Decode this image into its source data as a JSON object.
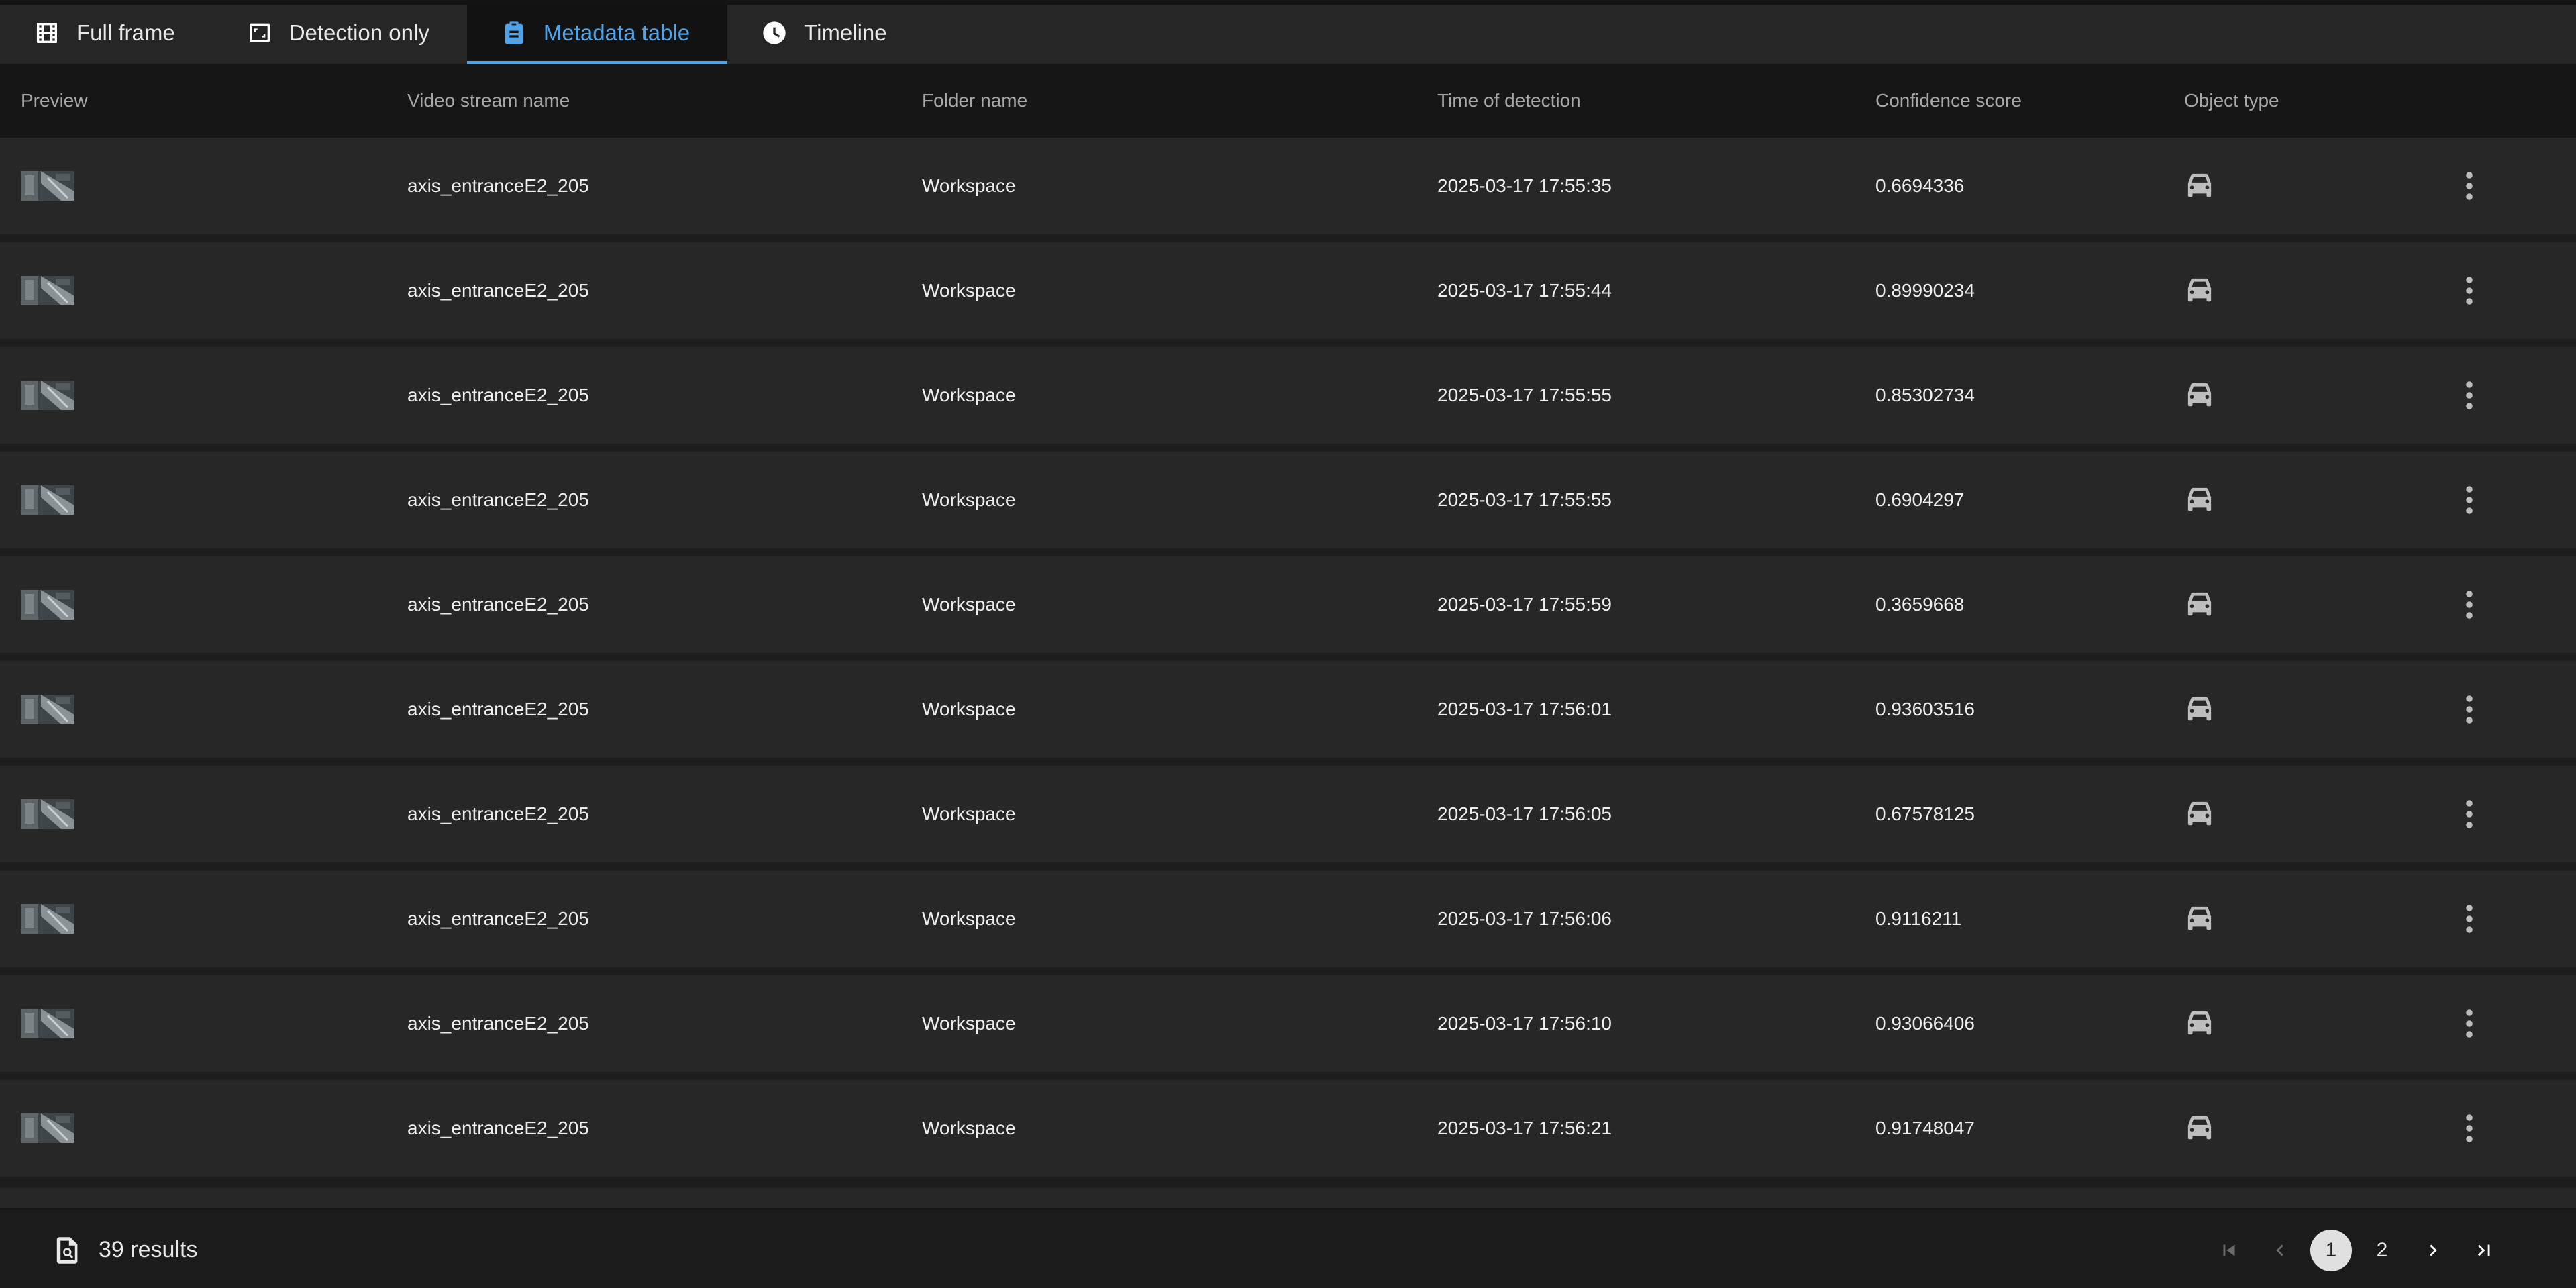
{
  "tabs": [
    {
      "label": "Full frame",
      "icon": "film-icon"
    },
    {
      "label": "Detection only",
      "icon": "crop-frame-icon"
    },
    {
      "label": "Metadata table",
      "icon": "clipboard-icon"
    },
    {
      "label": "Timeline",
      "icon": "clock-icon"
    }
  ],
  "active_tab": "Metadata table",
  "accent_color": "#4fa3e8",
  "table": {
    "columns": {
      "preview": "Preview",
      "stream": "Video stream name",
      "folder": "Folder name",
      "time": "Time of detection",
      "score": "Confidence score",
      "type": "Object type"
    },
    "rows": [
      {
        "stream": "axis_entranceE2_205",
        "folder": "Workspace",
        "time": "2025-03-17 17:55:35",
        "score": "0.6694336",
        "type_icon": "car-icon"
      },
      {
        "stream": "axis_entranceE2_205",
        "folder": "Workspace",
        "time": "2025-03-17 17:55:44",
        "score": "0.89990234",
        "type_icon": "car-icon"
      },
      {
        "stream": "axis_entranceE2_205",
        "folder": "Workspace",
        "time": "2025-03-17 17:55:55",
        "score": "0.85302734",
        "type_icon": "car-icon"
      },
      {
        "stream": "axis_entranceE2_205",
        "folder": "Workspace",
        "time": "2025-03-17 17:55:55",
        "score": "0.6904297",
        "type_icon": "car-icon"
      },
      {
        "stream": "axis_entranceE2_205",
        "folder": "Workspace",
        "time": "2025-03-17 17:55:59",
        "score": "0.3659668",
        "type_icon": "car-icon"
      },
      {
        "stream": "axis_entranceE2_205",
        "folder": "Workspace",
        "time": "2025-03-17 17:56:01",
        "score": "0.93603516",
        "type_icon": "car-icon"
      },
      {
        "stream": "axis_entranceE2_205",
        "folder": "Workspace",
        "time": "2025-03-17 17:56:05",
        "score": "0.67578125",
        "type_icon": "car-icon"
      },
      {
        "stream": "axis_entranceE2_205",
        "folder": "Workspace",
        "time": "2025-03-17 17:56:06",
        "score": "0.9116211",
        "type_icon": "car-icon"
      },
      {
        "stream": "axis_entranceE2_205",
        "folder": "Workspace",
        "time": "2025-03-17 17:56:10",
        "score": "0.93066406",
        "type_icon": "car-icon"
      },
      {
        "stream": "axis_entranceE2_205",
        "folder": "Workspace",
        "time": "2025-03-17 17:56:21",
        "score": "0.91748047",
        "type_icon": "car-icon"
      }
    ]
  },
  "footer": {
    "results_label": "39 results",
    "pages": [
      "1",
      "2"
    ],
    "current_page": "1"
  }
}
